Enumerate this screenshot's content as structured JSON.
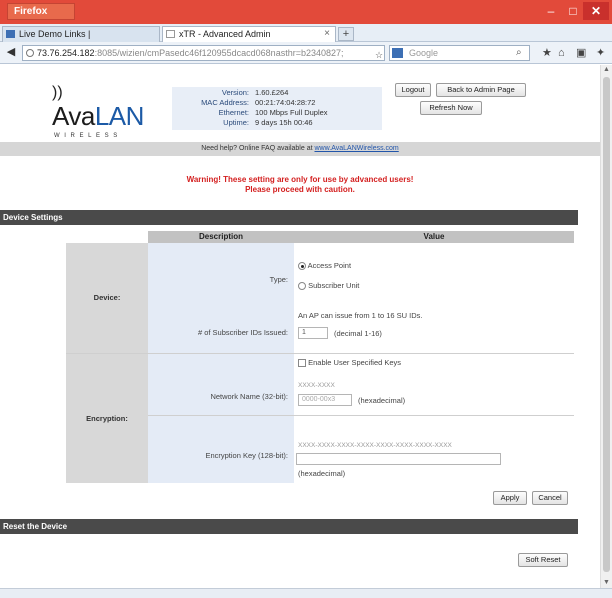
{
  "browser": {
    "menu_label": "Firefox",
    "window_controls": {
      "minimize": "–",
      "maximize": "□",
      "close": "✕"
    },
    "tabs": [
      {
        "label": "Live Demo Links |"
      },
      {
        "label": "xTR - Advanced Admin",
        "close": "×"
      }
    ],
    "new_tab": "+",
    "url_host": "73.76.254.182",
    "url_rest": ":8085/wizien/cmPasedc46f120955dcacd068nasthr=b2340827;",
    "url_suffix": "☆ ▾ C",
    "search_placeholder": "Google"
  },
  "header": {
    "logo_text_a": "Ava",
    "logo_text_b": "LAN",
    "logo_sub": "WIRELESS",
    "info": [
      {
        "label": "Version:",
        "value": "1.60.£264"
      },
      {
        "label": "MAC Address:",
        "value": "00:21:74:04:28:72"
      },
      {
        "label": "Ethernet:",
        "value": "100 Mbps Full Duplex"
      },
      {
        "label": "Uptime:",
        "value": "9 days 15h 00:46"
      }
    ],
    "logout_label": "Logout",
    "back_label": "Back to Admin Page",
    "refresh_label": "Refresh Now"
  },
  "help": {
    "prefix": "Need help?   Online FAQ available at ",
    "link": "www.AvaLANWireless.com"
  },
  "warning": {
    "line1": "Warning! These setting are only for use by advanced users!",
    "line2": "Please proceed with caution."
  },
  "device_settings": {
    "title": "Device Settings",
    "col_description": "Description",
    "col_value": "Value",
    "device": {
      "group": "Device:",
      "type_label": "Type:",
      "type_options": [
        "Access Point",
        "Subscriber Unit"
      ],
      "type_selected": 0,
      "subscriber_label": "# of Subscriber IDs Issued:",
      "subscriber_note": "An AP can issue from 1 to 16 SU IDs.",
      "subscriber_value": "1",
      "subscriber_hint": "(decimal 1-16)"
    },
    "encryption": {
      "group": "Encryption:",
      "user_keys_label": "Enable User Specified Keys",
      "network_name_label": "Network Name (32-bit):",
      "network_name_mask": "XXXX-XXXX",
      "network_name_value": "0000-00x3",
      "network_name_hint": "(hexadecimal)",
      "key_label": "Encryption Key (128-bit):",
      "key_mask": "XXXX-XXXX-XXXX-XXXX-XXXX-XXXX-XXXX-XXXX",
      "key_value": "",
      "key_hint": "(hexadecimal)"
    },
    "apply_label": "Apply",
    "cancel_label": "Cancel"
  },
  "reset": {
    "title": "Reset the Device",
    "soft_reset_label": "Soft Reset"
  }
}
